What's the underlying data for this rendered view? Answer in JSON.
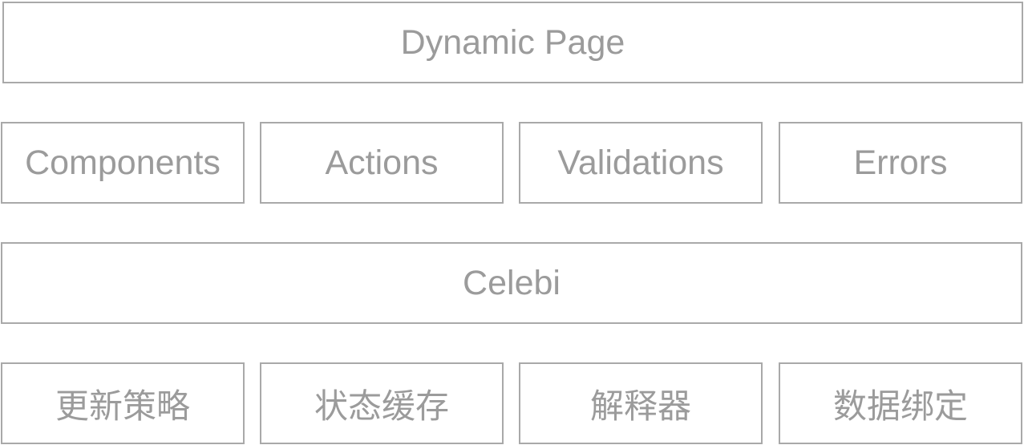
{
  "layers": {
    "top": {
      "label": "Dynamic Page"
    },
    "modules": [
      {
        "label": "Components"
      },
      {
        "label": "Actions"
      },
      {
        "label": "Validations"
      },
      {
        "label": "Errors"
      }
    ],
    "core": {
      "label": "Celebi"
    },
    "features": [
      {
        "label": "更新策略"
      },
      {
        "label": "状态缓存"
      },
      {
        "label": "解释器"
      },
      {
        "label": "数据绑定"
      }
    ]
  },
  "colors": {
    "border": "#a9a9a9",
    "text": "#9b9b9b",
    "background": "#ffffff"
  }
}
